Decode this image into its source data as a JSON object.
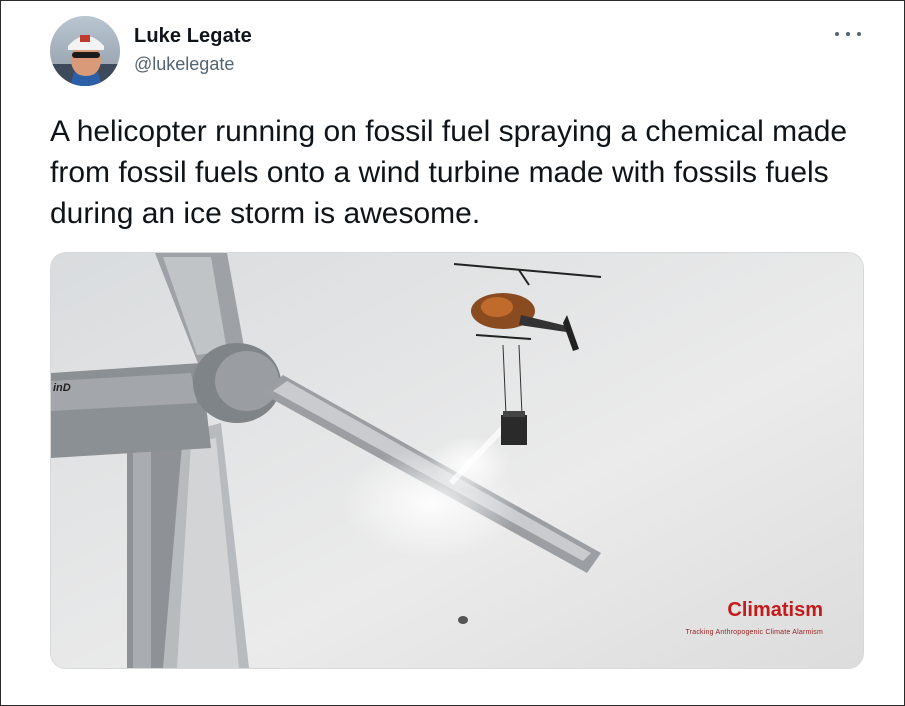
{
  "tweet": {
    "author_name": "Luke Legate",
    "author_handle": "@lukelegate",
    "text": "A helicopter running on fossil fuel spraying a chemical made from fossil fuels onto a wind turbine made with fossils fuels during an ice storm is awesome.",
    "avatar_icon": "avatar-photo",
    "menu_icon": "more-options-icon"
  },
  "media": {
    "watermark_title": "Climatism",
    "watermark_subtitle": "Tracking Anthropogenic Climate Alarmism",
    "nacelle_text": "inD"
  }
}
